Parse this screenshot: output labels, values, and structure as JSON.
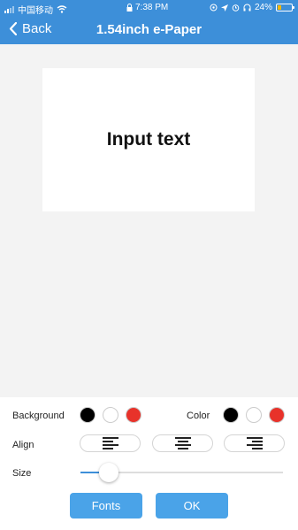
{
  "status_bar": {
    "carrier": "中国移动",
    "time": "7:38 PM",
    "battery": "24%",
    "battery_level": 0.24
  },
  "nav": {
    "back_label": "Back",
    "title": "1.54inch e-Paper"
  },
  "canvas": {
    "text": "Input text"
  },
  "controls": {
    "background_label": "Background",
    "color_label": "Color",
    "align_label": "Align",
    "size_label": "Size",
    "swatches": [
      "#000000",
      "#ffffff",
      "#e8322a"
    ],
    "align_options": [
      "left",
      "center",
      "right"
    ],
    "size_value": 0.14
  },
  "buttons": {
    "fonts": "Fonts",
    "ok": "OK"
  }
}
